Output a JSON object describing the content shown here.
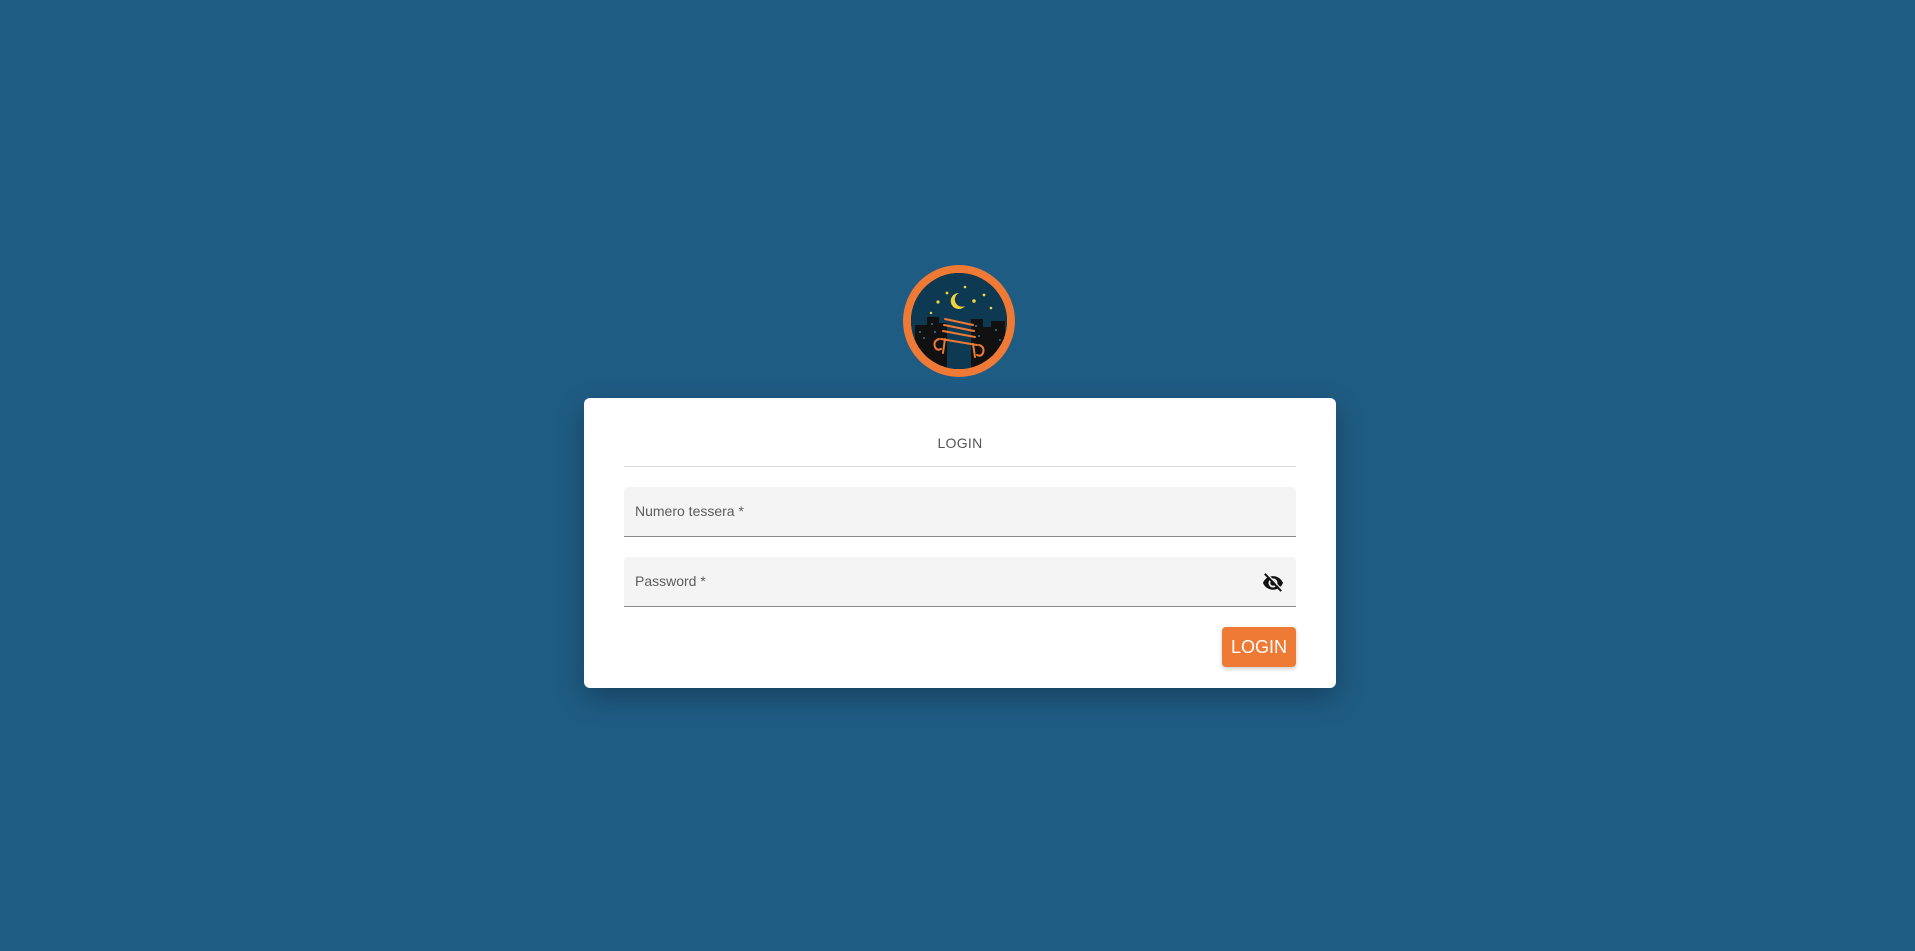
{
  "logo": {
    "icon": "night-bench-logo",
    "ring_color": "#ee7a35"
  },
  "card": {
    "title": "LOGIN"
  },
  "form": {
    "card_number": {
      "label": "Numero tessera *",
      "value": ""
    },
    "password": {
      "label": "Password *",
      "value": "",
      "toggle_icon": "eye-off-icon"
    }
  },
  "actions": {
    "login_label": "LOGIN"
  },
  "colors": {
    "background": "#1f5c84",
    "accent": "#ee7a35",
    "card": "#ffffff"
  }
}
